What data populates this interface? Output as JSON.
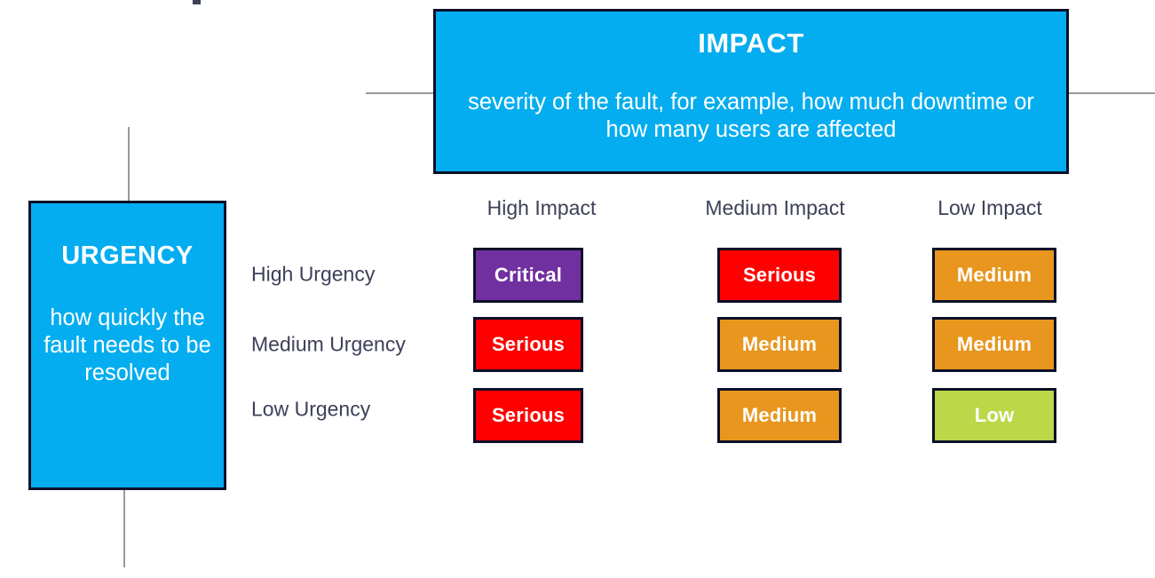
{
  "diagram": {
    "title_visible": false,
    "impact": {
      "title": "IMPACT",
      "description": "severity of the fault, for example, how much downtime or how many users are affected",
      "bg_color": "#03ADEF",
      "border_color": "#0D1028",
      "text_color": "#FFFFFF"
    },
    "urgency": {
      "title": "URGENCY",
      "description": "how quickly the fault needs to be resolved",
      "bg_color": "#03ADEF",
      "border_color": "#0D1028",
      "text_color": "#FFFFFF"
    }
  },
  "chart_data": {
    "type": "heatmap",
    "title": "Incident Priority Matrix: Impact vs Urgency",
    "xlabel": "Impact",
    "ylabel": "Urgency",
    "grid": false,
    "legend": "none",
    "column_headers": [
      "High Impact",
      "Medium Impact",
      "Low Impact"
    ],
    "row_headers": [
      "High Urgency",
      "Medium Urgency",
      "Low Urgency"
    ],
    "label_color": "#3D4059",
    "cells": [
      [
        {
          "label": "Critical",
          "color": "#7030A0",
          "text_color": "#FFFFFF"
        },
        {
          "label": "Serious",
          "color": "#FF0000",
          "text_color": "#FFFFFF"
        },
        {
          "label": "Medium",
          "color": "#E8961E",
          "text_color": "#FFFFFF"
        }
      ],
      [
        {
          "label": "Serious",
          "color": "#FF0000",
          "text_color": "#FFFFFF"
        },
        {
          "label": "Medium",
          "color": "#E8961E",
          "text_color": "#FFFFFF"
        },
        {
          "label": "Medium",
          "color": "#E8961E",
          "text_color": "#FFFFFF"
        }
      ],
      [
        {
          "label": "Serious",
          "color": "#FF0000",
          "text_color": "#FFFFFF"
        },
        {
          "label": "Medium",
          "color": "#E8961E",
          "text_color": "#FFFFFF"
        },
        {
          "label": "Low",
          "color": "#BCD748",
          "text_color": "#FFFFFF"
        }
      ]
    ],
    "priority_levels": [
      "Critical",
      "Serious",
      "Medium",
      "Low"
    ],
    "priority_colors": {
      "Critical": "#7030A0",
      "Serious": "#FF0000",
      "Medium": "#E8961E",
      "Low": "#BCD748"
    }
  },
  "connectors": {
    "color": "#9A9A9A"
  }
}
